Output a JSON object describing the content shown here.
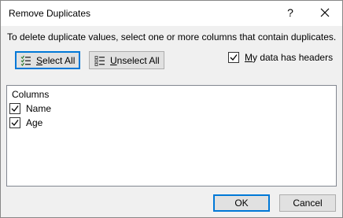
{
  "window": {
    "title": "Remove Duplicates",
    "help_glyph": "?"
  },
  "instruction": "To delete duplicate values, select one or more columns that contain duplicates.",
  "buttons": {
    "select_all": {
      "accel": "S",
      "rest": "elect All"
    },
    "unselect_all": {
      "accel": "U",
      "rest": "nselect All"
    },
    "ok": "OK",
    "cancel": "Cancel"
  },
  "headers_checkbox": {
    "accel": "M",
    "rest": "y data has headers",
    "checked": true
  },
  "columns": {
    "header": "Columns",
    "items": [
      {
        "label": "Name",
        "checked": true
      },
      {
        "label": "Age",
        "checked": true
      }
    ]
  },
  "colors": {
    "focus_border": "#0078d7",
    "button_face": "#e1e1e1",
    "dialog_bg": "#f0f0f0"
  }
}
